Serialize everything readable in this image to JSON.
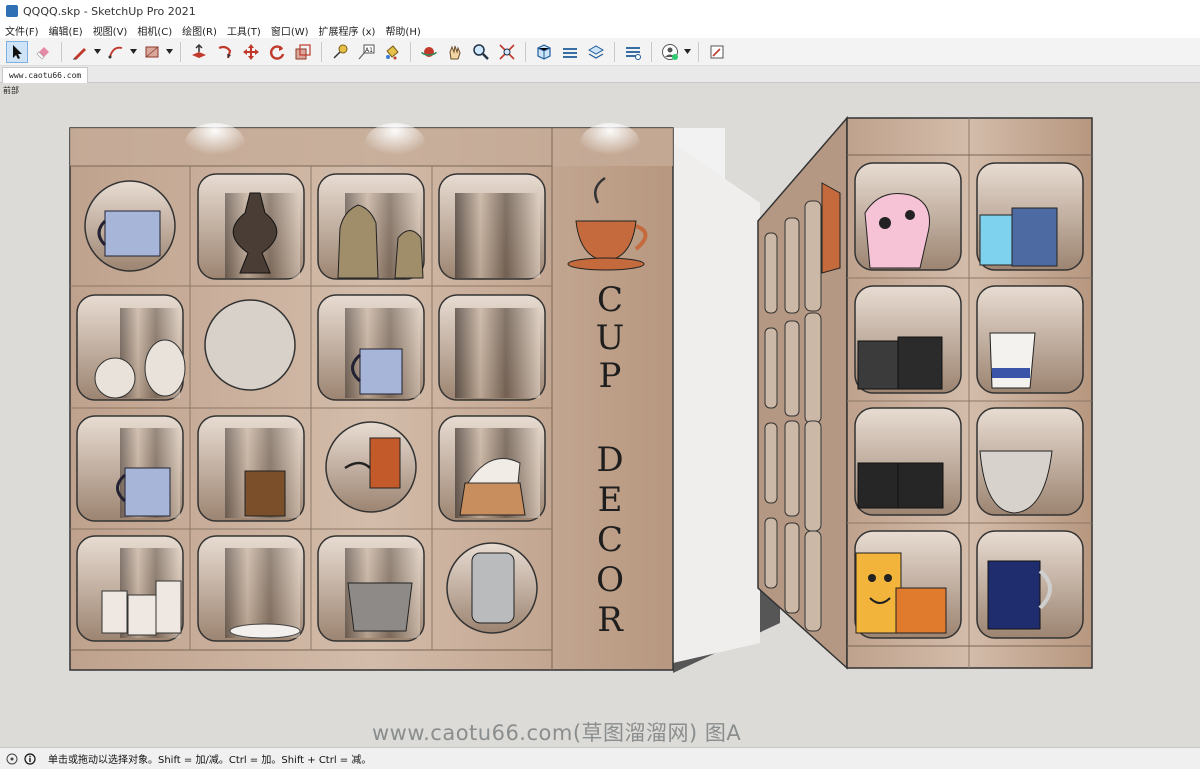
{
  "window": {
    "title": "QQQQ.skp - SketchUp Pro 2021"
  },
  "menu": [
    "文件(F)",
    "编辑(E)",
    "视图(V)",
    "相机(C)",
    "绘图(R)",
    "工具(T)",
    "窗口(W)",
    "扩展程序 (x)",
    "帮助(H)"
  ],
  "tab": {
    "label": "www.caotu66.com"
  },
  "viewport": {
    "scene_label": "前部",
    "sign_letters": [
      "C",
      "U",
      "P",
      "D",
      "E",
      "C",
      "O",
      "R"
    ]
  },
  "status": {
    "text": "单击或拖动以选择对象。Shift = 加/减。Ctrl = 加。Shift + Ctrl = 减。"
  },
  "watermark": "www.caotu66.com(草图溜溜网) 图A",
  "colors": {
    "viewport_bg": "#dcdbd7",
    "wood": "#c9b19c",
    "selection": "#cfe3f7"
  }
}
